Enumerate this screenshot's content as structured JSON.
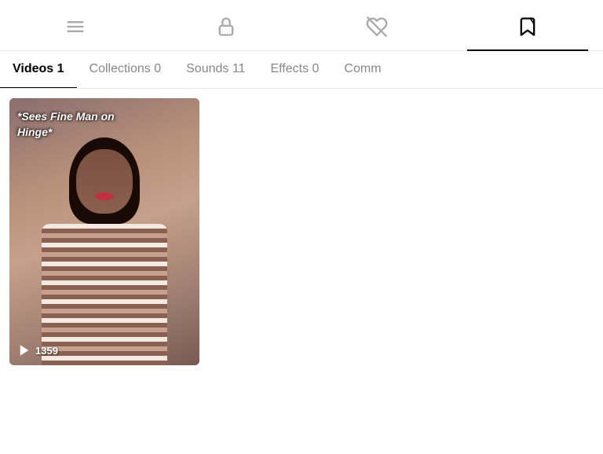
{
  "iconNav": {
    "items": [
      {
        "id": "menu-icon",
        "label": "Menu",
        "active": false
      },
      {
        "id": "lock-icon",
        "label": "Privacy",
        "active": false
      },
      {
        "id": "heart-icon",
        "label": "Likes",
        "active": false
      },
      {
        "id": "bookmark-icon",
        "label": "Saved",
        "active": true
      }
    ]
  },
  "tabs": [
    {
      "id": "tab-videos",
      "label": "Videos 1",
      "active": true
    },
    {
      "id": "tab-collections",
      "label": "Collections 0",
      "active": false
    },
    {
      "id": "tab-sounds",
      "label": "Sounds 11",
      "active": false
    },
    {
      "id": "tab-effects",
      "label": "Effects 0",
      "active": false
    },
    {
      "id": "tab-comm",
      "label": "Comm",
      "active": false
    }
  ],
  "videos": [
    {
      "id": "video-1",
      "overlayLine1": "*Sees Fine Man on",
      "overlayLine2": "Hinge*",
      "viewCount": "1359"
    }
  ]
}
